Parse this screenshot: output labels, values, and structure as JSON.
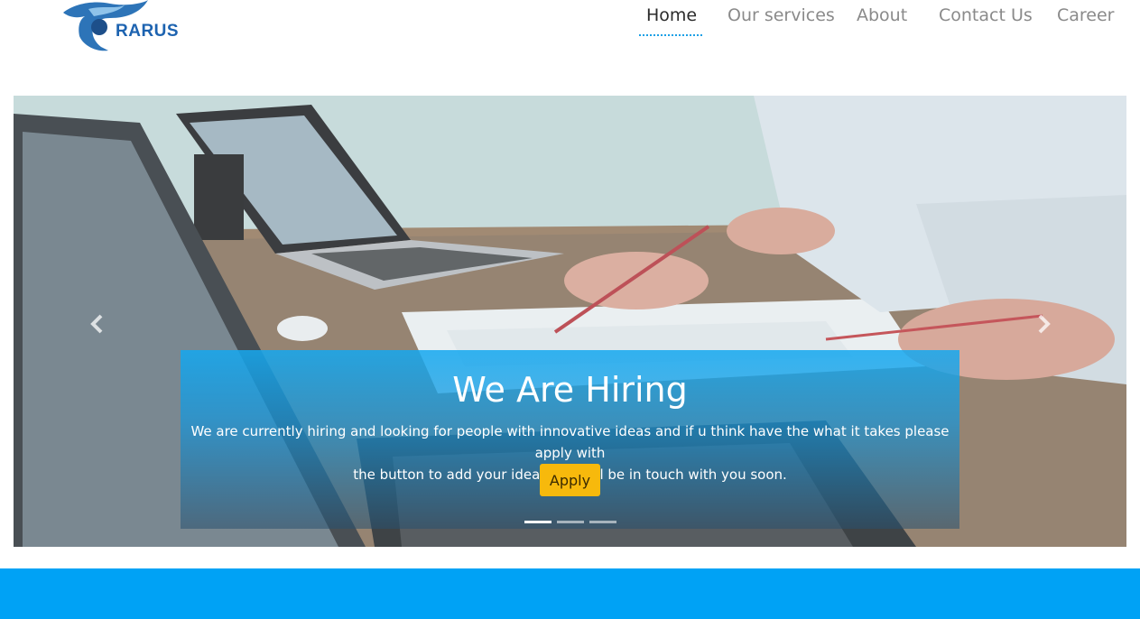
{
  "brand": {
    "name": "RARUS",
    "color": "#1d63b0"
  },
  "nav": {
    "items": [
      {
        "label": "Home",
        "active": true
      },
      {
        "label": "Our services",
        "active": false
      },
      {
        "label": "About",
        "active": false
      },
      {
        "label": "Contact Us",
        "active": false
      },
      {
        "label": "Career",
        "active": false
      }
    ],
    "active_underline_color": "#1aa0e6"
  },
  "carousel": {
    "prev_icon": "chevron-left-icon",
    "next_icon": "chevron-right-icon",
    "slide": {
      "title": "We Are Hiring",
      "text_line1": "We are currently hiring and looking for people with innovative ideas and if u think have the what it takes please apply with",
      "text_line2": "the button to add your ideas and will be in touch with you soon.",
      "button_label": "Apply"
    },
    "slide_count": 3,
    "active_slide": 1
  },
  "colors": {
    "caption_bg": "#14a8f0",
    "button_bg": "#f7b90c",
    "band_bg": "#00a2f5"
  }
}
